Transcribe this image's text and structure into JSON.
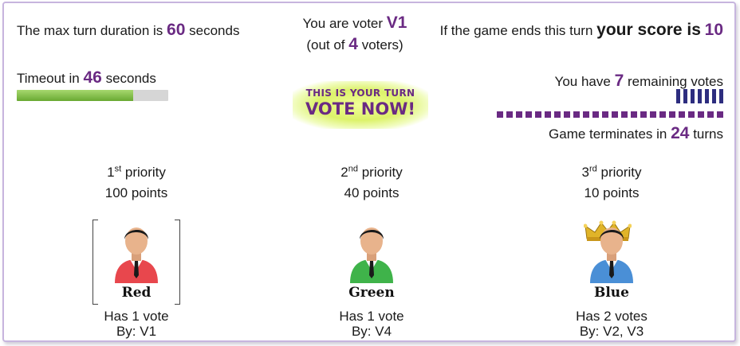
{
  "header": {
    "max_turn_prefix": "The max turn duration is",
    "max_turn_value": "60",
    "max_turn_suffix": "seconds",
    "timeout_prefix": "Timeout in",
    "timeout_value": "46",
    "timeout_suffix": "seconds",
    "timeout_fraction": 0.77,
    "voter_prefix": "You are voter",
    "voter_id": "V1",
    "voters_prefix": "(out of",
    "voters_count": "4",
    "voters_suffix": "voters)",
    "turn_line1": "THIS IS YOUR TURN",
    "turn_line2": "VOTE NOW!",
    "score_prefix": "If the game ends this turn",
    "score_bold": "your score is",
    "score_value": "10",
    "remaining_prefix": "You have",
    "remaining_value": "7",
    "remaining_suffix": "remaining votes",
    "remaining_count": 7,
    "terminates_prefix": "Game terminates in",
    "terminates_value": "24",
    "terminates_suffix": "turns",
    "turns_count": 24
  },
  "candidates": [
    {
      "rank": "1",
      "rank_suffix": "st",
      "priority_word": "priority",
      "points": "100 points",
      "name": "Red",
      "votes": "Has 1 vote",
      "by": "By: V1",
      "color": "#e8474d",
      "bracketed": true,
      "crowned": false
    },
    {
      "rank": "2",
      "rank_suffix": "nd",
      "priority_word": "priority",
      "points": "40 points",
      "name": "Green",
      "votes": "Has 1 vote",
      "by": "By: V4",
      "color": "#3fb34a",
      "bracketed": false,
      "crowned": false
    },
    {
      "rank": "3",
      "rank_suffix": "rd",
      "priority_word": "priority",
      "points": "10 points",
      "name": "Blue",
      "votes": "Has 2 votes",
      "by": "By: V2, V3",
      "color": "#4a8fd6",
      "bracketed": false,
      "crowned": true
    }
  ],
  "colors": {
    "accent": "#6a2a83",
    "vote_tick": "#2d2d7f",
    "timer_fill": "#7cbf3f",
    "frame": "#c7b5de"
  }
}
